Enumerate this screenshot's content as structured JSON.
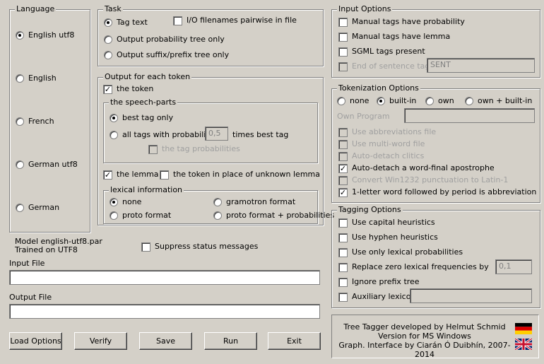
{
  "language": {
    "legend": "Language",
    "options": [
      "English utf8",
      "English",
      "French",
      "German utf8",
      "German"
    ],
    "selected": "English utf8"
  },
  "task": {
    "legend": "Task",
    "options": [
      "Tag text",
      "Output probability tree only",
      "Output suffix/prefix tree only"
    ],
    "selected": "Tag text",
    "io_pairwise": "I/O filenames pairwise in file"
  },
  "output_token": {
    "legend": "Output for each token",
    "the_token": "the token",
    "speech_parts": {
      "legend": "the speech-parts",
      "best_tag_only": "best tag only",
      "all_tags_prefix": "all tags with probability >",
      "threshold": "0,5",
      "all_tags_suffix": "times best tag",
      "tag_probabilities": "the tag probabilities"
    },
    "the_lemma": "the lemma",
    "token_unknown_lemma": "the token in place of unknown lemma",
    "lexical": {
      "legend": "lexical information",
      "none": "none",
      "gramotron": "gramotron format",
      "proto": "proto format",
      "proto_prob": "proto format + probabilities"
    }
  },
  "model": {
    "line1": "Model english-utf8.par",
    "line2": "Trained on UTF8"
  },
  "suppress_status": "Suppress status messages",
  "input_file": {
    "label": "Input File",
    "value": ""
  },
  "output_file": {
    "label": "Output File",
    "value": ""
  },
  "buttons": {
    "load": "Load Options",
    "verify": "Verify",
    "save": "Save",
    "run": "Run",
    "exit": "Exit"
  },
  "input_options": {
    "legend": "Input Options",
    "manual_prob": "Manual tags have probability",
    "manual_lemma": "Manual tags have lemma",
    "sgml": "SGML tags present",
    "end_sentence": "End of sentence tag",
    "end_sentence_value": "SENT"
  },
  "tokenization": {
    "legend": "Tokenization Options",
    "none": "none",
    "builtin": "built-in",
    "own": "own",
    "own_builtin": "own + built-in",
    "own_program": "Own Program",
    "abbrev_file": "Use abbreviations file",
    "multiword": "Use multi-word file",
    "clitics": "Auto-detach clitics",
    "apostrophe": "Auto-detach a word-final apostrophe",
    "win1232": "Convert Win1232 punctuation to Latin-1",
    "one_letter": "1-letter word followed by period is abbreviation"
  },
  "tagging": {
    "legend": "Tagging Options",
    "capital": "Use capital heuristics",
    "hyphen": "Use hyphen heuristics",
    "lexical_only": "Use only lexical probabilities",
    "replace_zero": "Replace zero lexical frequencies by",
    "replace_value": "0,1",
    "ignore_prefix": "Ignore prefix tree",
    "aux_lexicon": "Auxiliary lexicon"
  },
  "credits": {
    "line1": "Tree Tagger developed by Helmut Schmid",
    "line2": "Version for MS Windows",
    "line3": "Graph. Interface by Ciarán Ó Duibhín, 2007-2014"
  },
  "flags": [
    "german-flag-icon",
    "uk-flag-icon"
  ]
}
